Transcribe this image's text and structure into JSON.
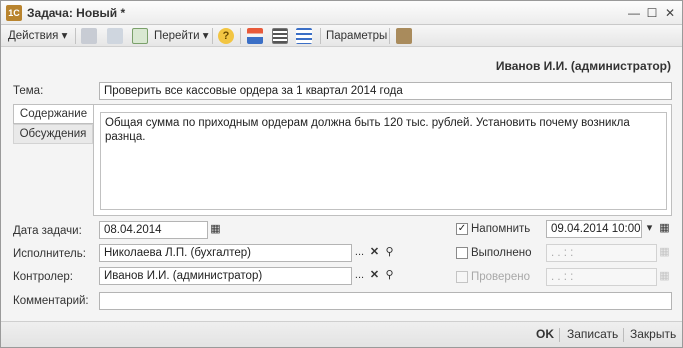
{
  "window": {
    "title": "Задача: Новый *"
  },
  "toolbar": {
    "actions_label": "Действия",
    "goto_label": "Перейти",
    "params_label": "Параметры"
  },
  "header": {
    "user": "Иванов И.И. (администратор)"
  },
  "form": {
    "subject_label": "Тема:",
    "subject_value": "Проверить все кассовые ордера за 1 квартал 2014 года",
    "tabs": [
      {
        "label": "Содержание"
      },
      {
        "label": "Обсуждения"
      }
    ],
    "content_text": "Общая сумма по приходным ордерам должна быть 120 тыс. рублей. Установить почему возникла разнца.",
    "task_date_label": "Дата задачи:",
    "task_date_value": "08.04.2014",
    "executor_label": "Исполнитель:",
    "executor_value": "Николаева Л.П. (бухгалтер)",
    "controller_label": "Контролер:",
    "controller_value": "Иванов И.И. (администратор)",
    "comment_label": "Комментарий:",
    "comment_value": "",
    "remind_label": "Напомнить",
    "remind_checked": true,
    "remind_value": "09.04.2014 10:00",
    "done_label": "Выполнено",
    "done_checked": false,
    "done_value": " .  .     :  :",
    "checked_label": "Проверено",
    "checked_checked": false,
    "checked_value": " .  .     :  :",
    "ellipsis": "...",
    "clear_glyph": "✕",
    "search_glyph": "⚲",
    "dropdown_glyph": "▾"
  },
  "bottom": {
    "ok_label": "OK",
    "save_label": "Записать",
    "close_label": "Закрыть"
  },
  "colors": {
    "accent": "#e2a33a",
    "window_bg": "#f4f4f4"
  }
}
